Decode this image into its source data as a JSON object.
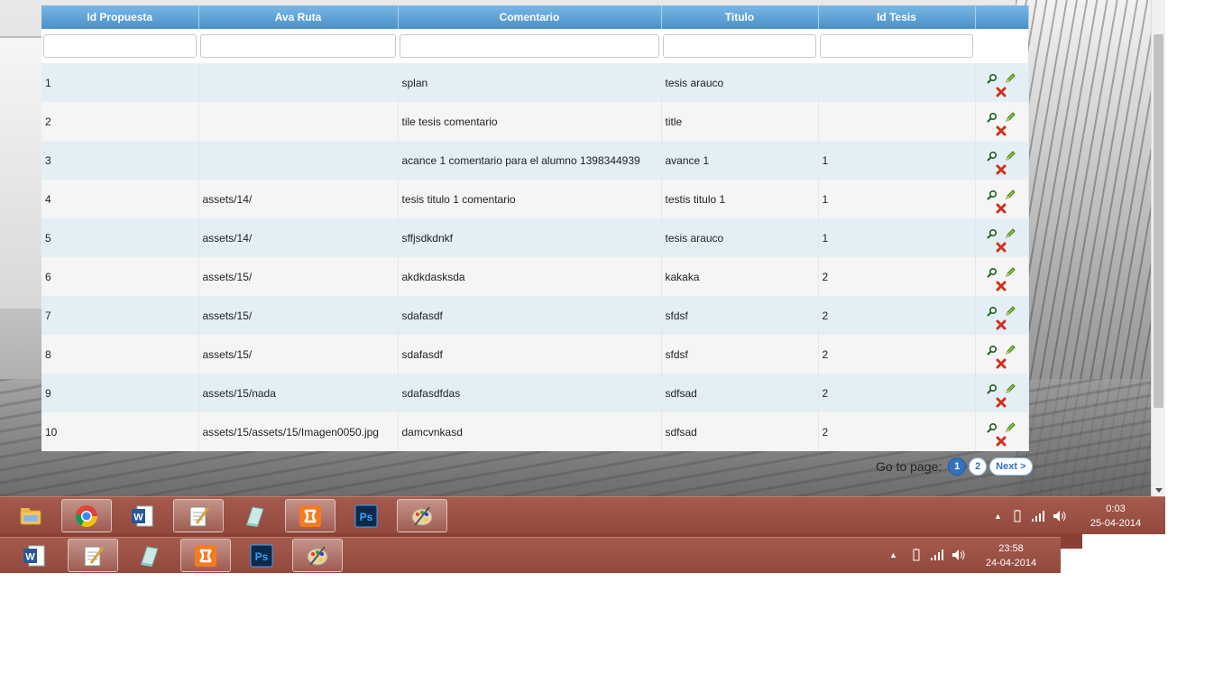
{
  "grid": {
    "columns": [
      "Id Propuesta",
      "Ava Ruta",
      "Comentario",
      "Titulo",
      "Id Tesis",
      ""
    ],
    "rows": [
      {
        "id": "1",
        "ruta": "",
        "comentario": "splan",
        "titulo": "tesis arauco",
        "tesis": ""
      },
      {
        "id": "2",
        "ruta": "",
        "comentario": "tile tesis comentario",
        "titulo": "title",
        "tesis": ""
      },
      {
        "id": "3",
        "ruta": "",
        "comentario": "acance 1 comentario para el alumno 1398344939",
        "titulo": "avance 1",
        "tesis": "1"
      },
      {
        "id": "4",
        "ruta": "assets/14/",
        "comentario": "tesis titulo 1 comentario",
        "titulo": "testis titulo 1",
        "tesis": "1"
      },
      {
        "id": "5",
        "ruta": "assets/14/",
        "comentario": "sffjsdkdnkf",
        "titulo": "tesis arauco",
        "tesis": "1"
      },
      {
        "id": "6",
        "ruta": "assets/15/",
        "comentario": "akdkdasksda",
        "titulo": "kakaka",
        "tesis": "2"
      },
      {
        "id": "7",
        "ruta": "assets/15/",
        "comentario": "sdafasdf",
        "titulo": "sfdsf",
        "tesis": "2"
      },
      {
        "id": "8",
        "ruta": "assets/15/",
        "comentario": "sdafasdf",
        "titulo": "sfdsf",
        "tesis": "2"
      },
      {
        "id": "9",
        "ruta": "assets/15/nada",
        "comentario": "sdafasdfdas",
        "titulo": "sdfsad",
        "tesis": "2"
      },
      {
        "id": "10",
        "ruta": "assets/15/assets/15/Imagen0050.jpg",
        "comentario": "damcvnkasd",
        "titulo": "sdfsad",
        "tesis": "2"
      }
    ],
    "action_icons": [
      "magnifier-icon",
      "pencil-icon",
      "delete-x-icon"
    ]
  },
  "pager": {
    "label": "Go to page:",
    "pages": [
      "1",
      "2"
    ],
    "current": "1",
    "next": "Next >"
  },
  "taskbar_top": {
    "apps": [
      "folder-icon",
      "chrome-icon",
      "word-icon",
      "notepad-icon",
      "notebook-icon",
      "xampp-icon",
      "photoshop-icon",
      "paint-icon"
    ],
    "active_app": "chrome-icon",
    "ps_label": "Ps",
    "time": "0:03",
    "date": "25-04-2014"
  },
  "taskbar_bottom": {
    "apps": [
      "word-icon",
      "notepad-icon",
      "notebook-icon",
      "xampp-icon",
      "photoshop-icon",
      "paint-icon"
    ],
    "ps_label": "Ps",
    "time": "23:58",
    "date": "24-04-2014"
  },
  "colors": {
    "header_blue": "#4a90c8",
    "row_alt": "#e4eff5",
    "taskbar": "#9a4f42",
    "pager_active": "#3272be"
  }
}
